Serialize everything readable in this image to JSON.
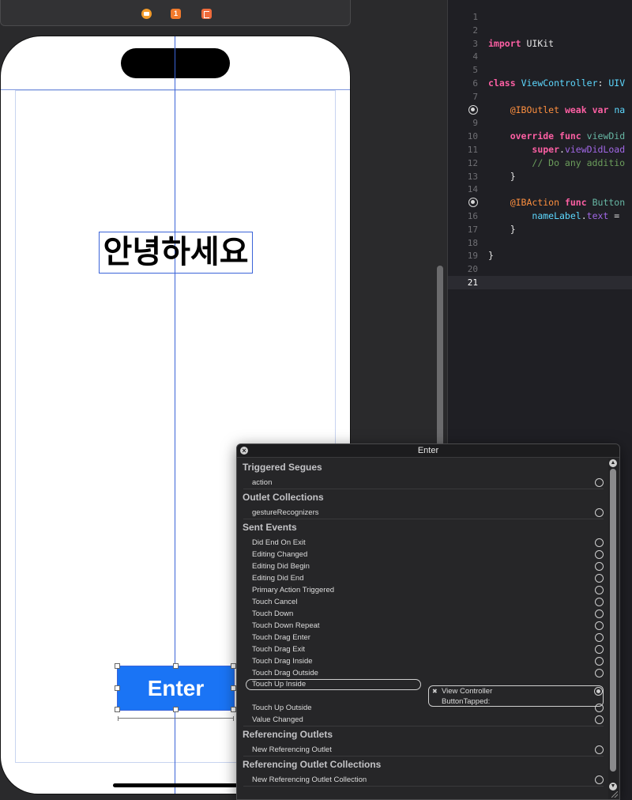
{
  "scene_bar": {
    "icons": [
      "view-controller-icon",
      "first-responder-icon",
      "exit-icon"
    ],
    "first_responder_badge": "1"
  },
  "canvas": {
    "greeting_label": "안녕하세요",
    "enter_button": "Enter"
  },
  "editor": {
    "current_line": 21,
    "lines": [
      {
        "n": "1",
        "html": ""
      },
      {
        "n": "2",
        "html": ""
      },
      {
        "n": "3",
        "html": "<span class='kw'>import</span> UIKit"
      },
      {
        "n": "4",
        "html": ""
      },
      {
        "n": "5",
        "html": ""
      },
      {
        "n": "6",
        "html": "<span class='kw'>class</span> <span class='ty'>ViewController</span>: <span class='ty'>UIV</span>"
      },
      {
        "n": "7",
        "html": ""
      },
      {
        "n": "",
        "dot": true,
        "html": "    <span class='at'>@IBOutlet</span> <span class='kw'>weak</span> <span class='kw'>var</span> <span class='ty'>na</span>"
      },
      {
        "n": "9",
        "html": ""
      },
      {
        "n": "10",
        "html": "    <span class='kw'>override</span> <span class='kw'>func</span> <span class='mth'>viewDid</span>"
      },
      {
        "n": "11",
        "html": "        <span class='kw'>super</span>.<span class='prop'>viewDidLoad</span>"
      },
      {
        "n": "12",
        "html": "        <span class='cm'>// Do any additio</span>"
      },
      {
        "n": "13",
        "html": "    }"
      },
      {
        "n": "14",
        "html": ""
      },
      {
        "n": "",
        "dot": true,
        "html": "    <span class='at'>@IBAction</span> <span class='kw'>func</span> <span class='mth'>Button</span>"
      },
      {
        "n": "16",
        "html": "        <span class='ty'>nameLabel</span>.<span class='prop'>text</span> ="
      },
      {
        "n": "17",
        "html": "    }"
      },
      {
        "n": "18",
        "html": ""
      },
      {
        "n": "19",
        "html": "}"
      },
      {
        "n": "20",
        "html": ""
      },
      {
        "n": "21",
        "html": ""
      }
    ]
  },
  "inspector": {
    "title": "Enter",
    "close_label": "×",
    "sections": [
      {
        "title": "Triggered Segues",
        "rows": [
          "action"
        ]
      },
      {
        "title": "Outlet Collections",
        "rows": [
          "gestureRecognizers"
        ]
      },
      {
        "title": "Sent Events",
        "rows": [
          "Did End On Exit",
          "Editing Changed",
          "Editing Did Begin",
          "Editing Did End",
          "Primary Action Triggered",
          "Touch Cancel",
          "Touch Down",
          "Touch Down Repeat",
          "Touch Drag Enter",
          "Touch Drag Exit",
          "Touch Drag Inside",
          "Touch Drag Outside",
          "Touch Up Inside",
          "Touch Up Outside",
          "Value Changed"
        ]
      },
      {
        "title": "Referencing Outlets",
        "rows": [
          "New Referencing Outlet"
        ]
      },
      {
        "title": "Referencing Outlet Collections",
        "rows": [
          "New Referencing Outlet Collection"
        ]
      }
    ],
    "connected_event": "Touch Up Inside",
    "connection": {
      "target": "View Controller",
      "action": "ButtonTapped:",
      "remove_label": "✖"
    }
  }
}
